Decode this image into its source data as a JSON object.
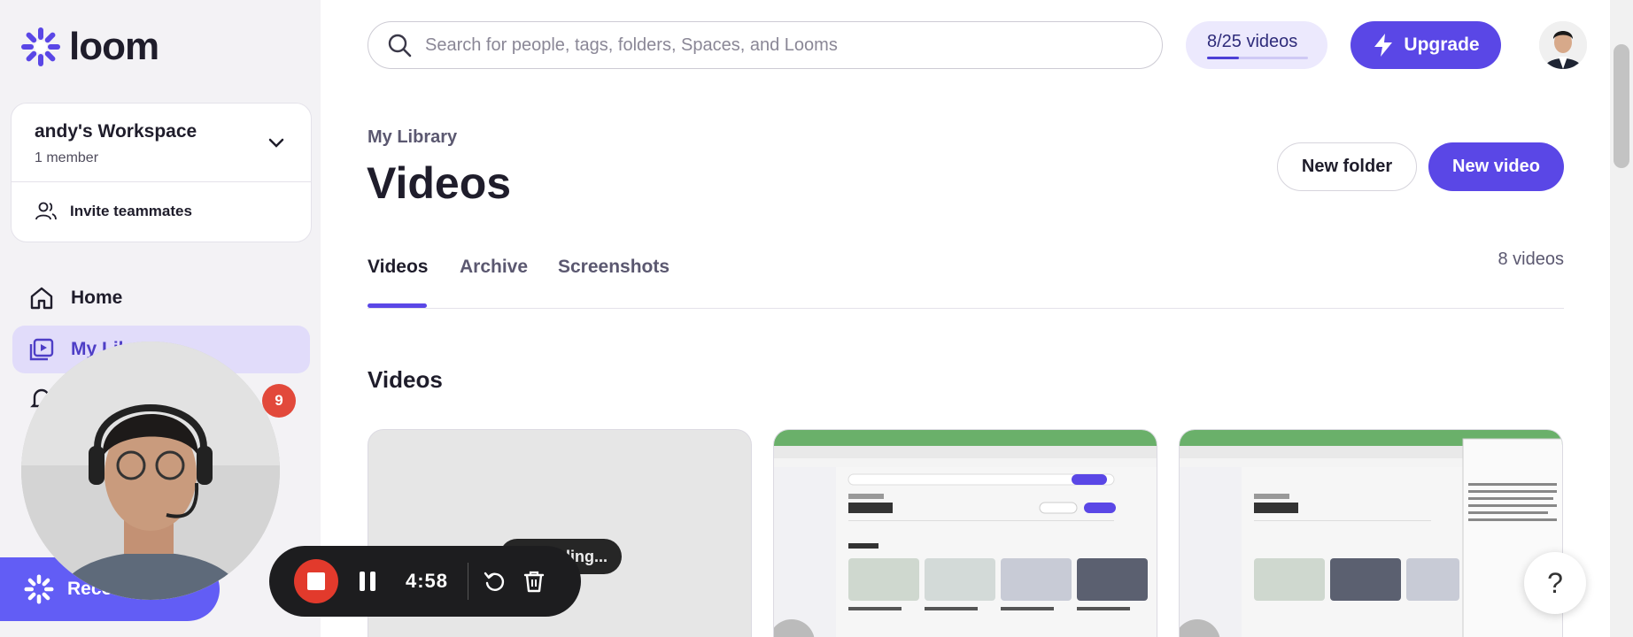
{
  "sidebar": {
    "logo_text": "loom",
    "workspace": {
      "name": "andy's Workspace",
      "members": "1 member",
      "invite_label": "Invite teammates"
    },
    "nav": [
      {
        "label": "Home",
        "icon": "home-icon"
      },
      {
        "label": "My Libr",
        "icon": "library-icon"
      },
      {
        "label": "",
        "icon": "bell-icon"
      }
    ],
    "notifications_badge": "9",
    "record_label": "Reco"
  },
  "header": {
    "search_placeholder": "Search for people, tags, folders, Spaces, and Looms",
    "quota_text": "8/25 videos",
    "quota_progress": 0.32,
    "upgrade_label": "Upgrade"
  },
  "main": {
    "breadcrumb": "My Library",
    "title": "Videos",
    "new_folder_label": "New folder",
    "new_video_label": "New video",
    "tabs": [
      {
        "label": "Videos",
        "active": true
      },
      {
        "label": "Archive",
        "active": false
      },
      {
        "label": "Screenshots",
        "active": false
      }
    ],
    "video_count": "8 videos",
    "section_title": "Videos",
    "processing_label": "ling..."
  },
  "recording": {
    "timer": "4:58"
  },
  "help_label": "?",
  "colors": {
    "accent": "#5a47e6",
    "record_red": "#e23a2c",
    "badge_red": "#e2493b"
  }
}
